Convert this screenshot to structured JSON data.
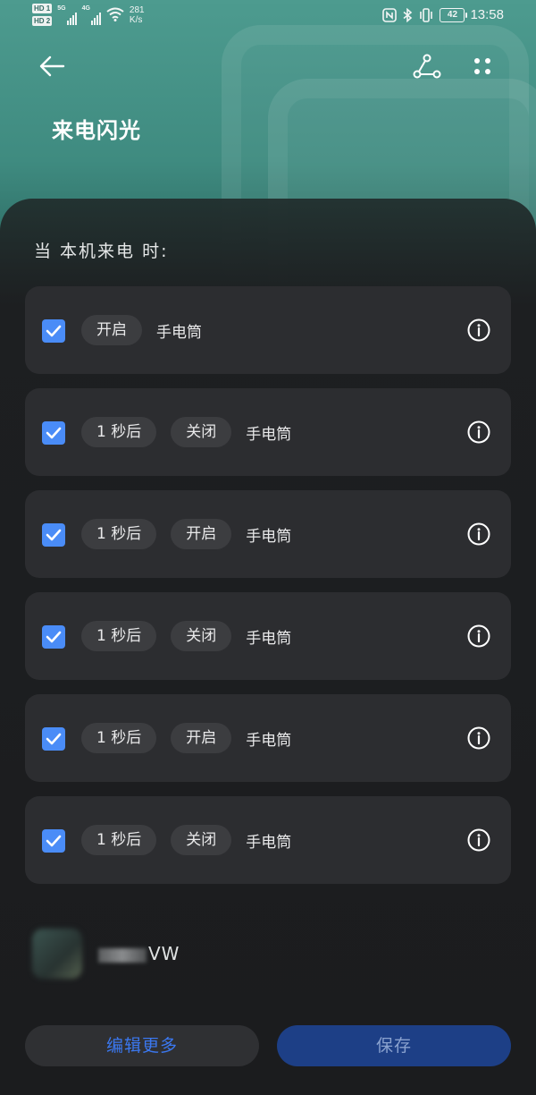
{
  "status_bar": {
    "hd1": "HD 1",
    "hd2": "HD 2",
    "net1": "5G",
    "net2": "4G",
    "speed_value": "281",
    "speed_unit": "K/s",
    "battery": "42",
    "time": "13:58",
    "icons": [
      "nfc-icon",
      "bluetooth-icon",
      "vibrate-icon",
      "battery-icon"
    ]
  },
  "header": {
    "title": "来电闪光",
    "icons": [
      "back-arrow-icon",
      "share-icon",
      "more-dots-icon"
    ]
  },
  "section_label": "当 本机来电 时:",
  "rules": [
    {
      "checked": true,
      "delay": "",
      "action": "开启",
      "target": "手电筒"
    },
    {
      "checked": true,
      "delay": "1 秒后",
      "action": "关闭",
      "target": "手电筒"
    },
    {
      "checked": true,
      "delay": "1 秒后",
      "action": "开启",
      "target": "手电筒"
    },
    {
      "checked": true,
      "delay": "1 秒后",
      "action": "关闭",
      "target": "手电筒"
    },
    {
      "checked": true,
      "delay": "1 秒后",
      "action": "开启",
      "target": "手电筒"
    },
    {
      "checked": true,
      "delay": "1 秒后",
      "action": "关闭",
      "target": "手电筒"
    }
  ],
  "footer_item": {
    "text_suffix": "VW"
  },
  "buttons": {
    "edit_more": "编辑更多",
    "save": "保存"
  },
  "colors": {
    "accent_blue": "#4a8cf7",
    "header_teal": "#4d9b8f",
    "card_bg": "#2c2d30",
    "save_bg": "#1d3f86"
  }
}
